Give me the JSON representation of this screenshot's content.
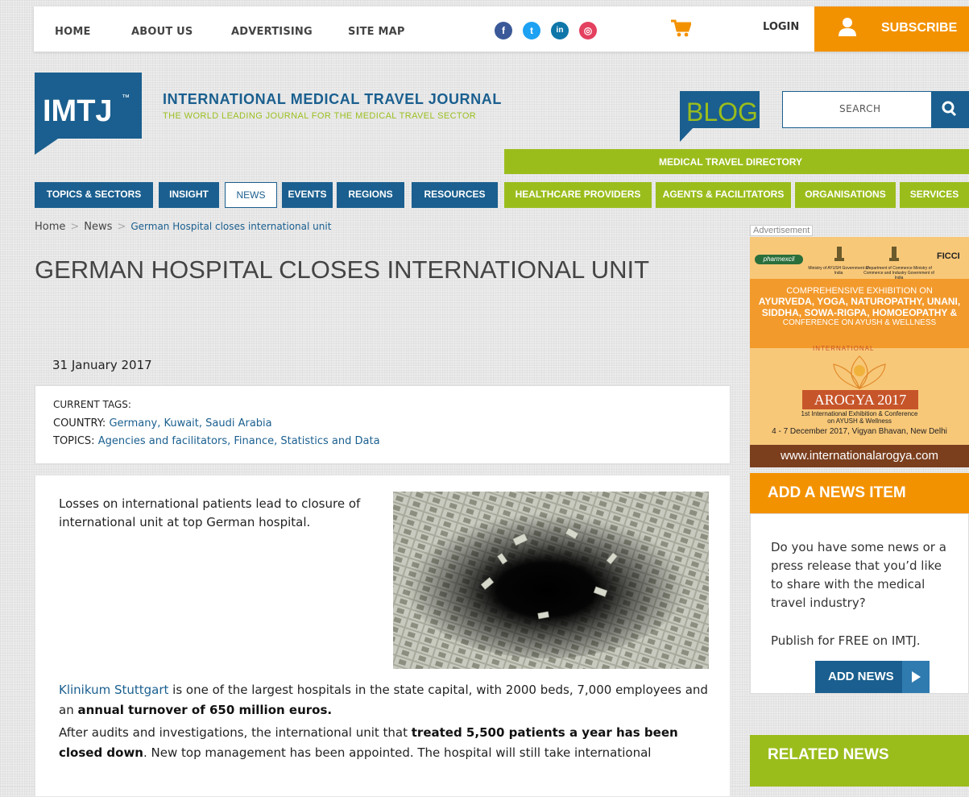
{
  "topbar": {
    "nav": [
      "HOME",
      "ABOUT US",
      "ADVERTISING",
      "SITE MAP"
    ],
    "social": [
      {
        "icon": "facebook-icon",
        "glyph": "f",
        "color": "#3b5998"
      },
      {
        "icon": "twitter-icon",
        "glyph": "t",
        "color": "#1da1f2"
      },
      {
        "icon": "linkedin-icon",
        "glyph": "in",
        "color": "#0e76a8"
      },
      {
        "icon": "instagram-icon",
        "glyph": "◎",
        "color": "#e4405f"
      }
    ],
    "cart_icon": "shopping-cart-icon",
    "login": "LOGIN",
    "subscribe": "SUBSCRIBE"
  },
  "brand": {
    "logo_text": "IMTJ",
    "logo_tm": "™",
    "title": "INTERNATIONAL MEDICAL TRAVEL JOURNAL",
    "subtitle": "THE WORLD LEADING JOURNAL FOR THE MEDICAL TRAVEL SECTOR",
    "blog": "BLOG"
  },
  "search": {
    "placeholder": "SEARCH"
  },
  "directory": {
    "label": "MEDICAL TRAVEL DIRECTORY",
    "items": [
      "HEALTHCARE PROVIDERS",
      "AGENTS & FACILITATORS",
      "ORGANISATIONS",
      "SERVICES"
    ]
  },
  "mainnav": [
    "TOPICS & SECTORS",
    "INSIGHT",
    "NEWS",
    "EVENTS",
    "REGIONS",
    "RESOURCES"
  ],
  "breadcrumb": {
    "home": "Home",
    "sep": ">",
    "news": "News",
    "current": "German Hospital closes international unit"
  },
  "article": {
    "title": "GERMAN HOSPITAL CLOSES INTERNATIONAL UNIT",
    "date": "31 January 2017",
    "tags_heading": "CURRENT TAGS:",
    "country_label": "COUNTRY:",
    "countries": "Germany, Kuwait, Saudi Arabia",
    "topics_label": "TOPICS:",
    "topics": "Agencies and facilitators, Finance, Statistics and Data",
    "intro": "Losses on international patients lead to closure of international unit at top German hospital.",
    "p1_link": "Klinikum Stuttgart",
    "p1_text": " is one of the largest hospitals in the state capital, with 2000 beds, 7,000 employees and an ",
    "p1_bold": "annual turnover of 650 million euros.",
    "p2_text": "After audits and investigations, the international unit that ",
    "p2_bold": "treated 5,500 patients a year has been closed down",
    "p2_rest": ". New top management has been appointed. The hospital will still take international"
  },
  "ad": {
    "label": "Advertisement",
    "logo_left": "pharmexcil",
    "logo_right": "FICCI",
    "ministry1": "Ministry of AYUSH Government of India",
    "ministry2": "Department of Commerce Ministry of Commerce and Industry Government of India",
    "line1": "COMPREHENSIVE EXHIBITION ON",
    "line2": "AYURVEDA, YOGA, NATUROPATHY, UNANI,",
    "line3": "SIDDHA, SOWA-RIGPA, HOMOEOPATHY &",
    "line4": "CONFERENCE ON AYUSH & WELLNESS",
    "arc": "INTERNATIONAL",
    "event": "AROGYA 2017",
    "event_sub1": "1st International Exhibition & Conference",
    "event_sub2": "on AYUSH & Wellness",
    "dates": "4 - 7 December 2017, Vigyan Bhavan, New Delhi",
    "url": "www.internationalarogya.com"
  },
  "sidebar": {
    "add_news_title": "ADD A NEWS ITEM",
    "add_news_text": "Do you have some news or a press release that you’d like to share with the medical travel industry?",
    "publish": "Publish for FREE on IMTJ.",
    "add_news_btn": "ADD NEWS",
    "related_title": "RELATED NEWS"
  },
  "colors": {
    "brand_blue": "#1a5f8f",
    "brand_green": "#9bbd1c",
    "brand_orange": "#f39200"
  }
}
